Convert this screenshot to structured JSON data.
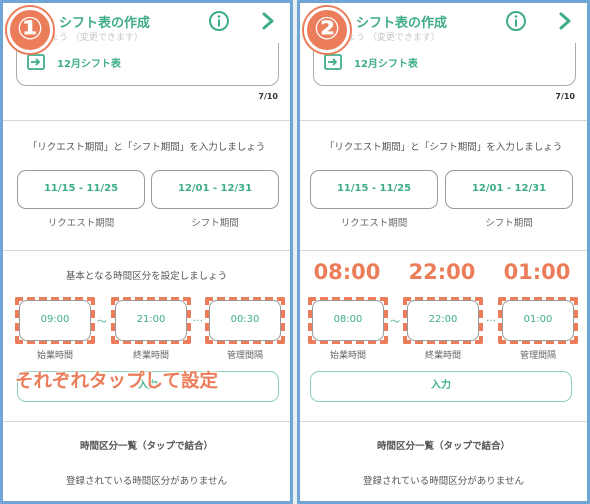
{
  "colors": {
    "accent": "#3fae86",
    "highlight": "#ec7d5a",
    "frame": "#6fa6d6"
  },
  "panels": [
    {
      "badge": "①",
      "header": {
        "title": "シフト表の作成",
        "info_icon": "info-icon",
        "next_icon": "chevron-right-icon",
        "ghost": "しましょう （変更できます）"
      },
      "month": {
        "label": "12月シフト表",
        "icon": "calendar-arrow-icon"
      },
      "page_count": "7/10",
      "period_prompt": "「リクエスト期間」と「シフト期間」を入力しましょう",
      "request_period": {
        "value": "11/15 - 11/25",
        "label": "リクエスト期間"
      },
      "shift_period": {
        "value": "12/01 - 12/31",
        "label": "シフト期間"
      },
      "time_prompt": "基本となる時間区分を設定しましょう",
      "start": {
        "value": "09:00",
        "label": "始業時間"
      },
      "end": {
        "value": "21:00",
        "label": "終業時間"
      },
      "interval": {
        "value": "00:30",
        "label": "管理間隔"
      },
      "tilde": "～",
      "ellipsis": "…",
      "input_label": "入力",
      "overlay_caption": "それぞれタップして設定",
      "list_title": "時間区分一覧（タップで結合）",
      "empty_text": "登録されている時間区分がありません"
    },
    {
      "badge": "②",
      "header": {
        "title": "シフト表の作成",
        "info_icon": "info-icon",
        "next_icon": "chevron-right-icon",
        "ghost": "しましょう （変更できます）"
      },
      "month": {
        "label": "12月シフト表",
        "icon": "calendar-arrow-icon"
      },
      "page_count": "7/10",
      "period_prompt": "「リクエスト期間」と「シフト期間」を入力しましょう",
      "request_period": {
        "value": "11/15 - 11/25",
        "label": "リクエスト期間"
      },
      "shift_period": {
        "value": "12/01 - 12/31",
        "label": "シフト期間"
      },
      "big_values": [
        "08:00",
        "22:00",
        "01:00"
      ],
      "start": {
        "value": "08:00",
        "label": "始業時間"
      },
      "end": {
        "value": "22:00",
        "label": "終業時間"
      },
      "interval": {
        "value": "01:00",
        "label": "管理間隔"
      },
      "tilde": "～",
      "ellipsis": "…",
      "input_label": "入力",
      "list_title": "時間区分一覧（タップで結合）",
      "empty_text": "登録されている時間区分がありません"
    }
  ]
}
